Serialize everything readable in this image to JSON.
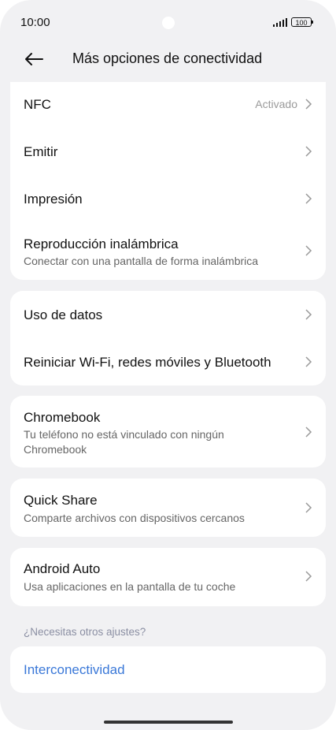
{
  "status": {
    "time": "10:00",
    "battery": "100"
  },
  "header": {
    "title": "Más opciones de conectividad"
  },
  "items": [
    {
      "label": "NFC",
      "value": "Activado"
    },
    {
      "label": "Emitir"
    },
    {
      "label": "Impresión"
    },
    {
      "label": "Reproducción inalámbrica",
      "sub": "Conectar con una pantalla de forma inalámbrica"
    },
    {
      "label": "Uso de datos"
    },
    {
      "label": "Reiniciar Wi-Fi, redes móviles y Bluetooth"
    },
    {
      "label": "Chromebook",
      "sub": "Tu teléfono no está vinculado con ningún Chromebook"
    },
    {
      "label": "Quick Share",
      "sub": "Comparte archivos con dispositivos cercanos"
    },
    {
      "label": "Android Auto",
      "sub": "Usa aplicaciones en la pantalla de tu coche"
    }
  ],
  "other": {
    "section_label": "¿Necesitas otros ajustes?",
    "link_label": "Interconectividad"
  },
  "colors": {
    "background": "#f1f1f3",
    "card": "#ffffff",
    "link": "#3a78d8"
  }
}
